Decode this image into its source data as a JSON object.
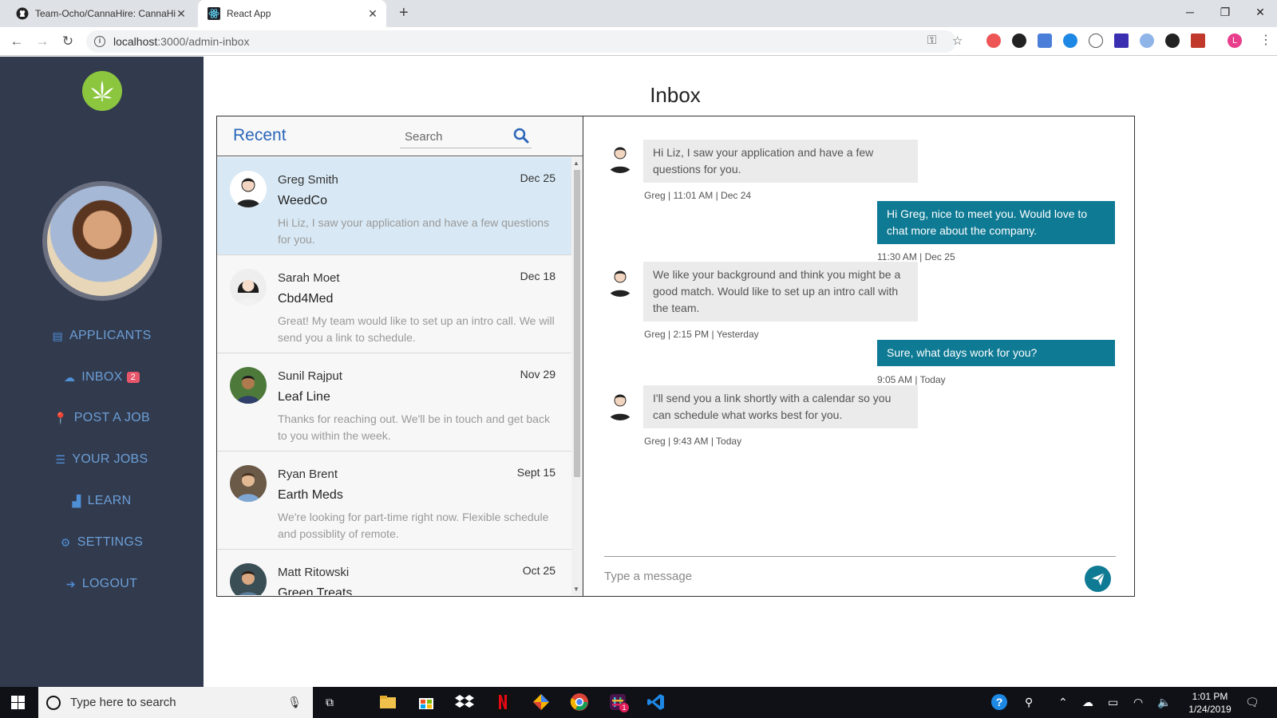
{
  "browser": {
    "tabs": [
      {
        "title": "Team-Ocho/CannaHire: CannaHire",
        "icon": "github-icon"
      },
      {
        "title": "React App",
        "icon": "react-icon"
      }
    ],
    "url_host": "localhost",
    "url_path": ":3000/admin-inbox",
    "new_tab": "+",
    "profile_initial": "L"
  },
  "sidebar": {
    "nav": [
      {
        "label": "APPLICANTS",
        "icon": "applicants-icon"
      },
      {
        "label": "INBOX",
        "icon": "inbox-icon",
        "badge": "2"
      },
      {
        "label": "POST A JOB",
        "icon": "pin-icon"
      },
      {
        "label": "YOUR JOBS",
        "icon": "list-icon"
      },
      {
        "label": "LEARN",
        "icon": "chart-icon"
      },
      {
        "label": "SETTINGS",
        "icon": "gear-icon"
      },
      {
        "label": "LOGOUT",
        "icon": "logout-icon"
      }
    ]
  },
  "page": {
    "title": "Inbox"
  },
  "recent": {
    "title": "Recent",
    "search_placeholder": "Search",
    "conversations": [
      {
        "name": "Greg Smith",
        "date": "Dec 25",
        "company": "WeedCo",
        "snippet": "Hi Liz, I saw your application and have a few questions for you."
      },
      {
        "name": "Sarah Moet",
        "date": "Dec 18",
        "company": "Cbd4Med",
        "snippet": "Great! My team would like to set up an intro call. We will send you a link to schedule."
      },
      {
        "name": "Sunil Rajput",
        "date": "Nov 29",
        "company": "Leaf Line",
        "snippet": "Thanks for reaching out. We'll be in touch and get back to you within the week."
      },
      {
        "name": "Ryan Brent",
        "date": "Sept 15",
        "company": "Earth Meds",
        "snippet": "We're looking for part-time right now. Flexible schedule and possiblity of remote."
      },
      {
        "name": "Matt Ritowski",
        "date": "Oct 25",
        "company": "Green Treats",
        "snippet": ""
      }
    ]
  },
  "thread": {
    "messages": [
      {
        "dir": "in",
        "text": "Hi Liz, I saw your application and have a few questions for you.",
        "meta": "Greg | 11:01 AM | Dec 24"
      },
      {
        "dir": "out",
        "text": "Hi Greg, nice to meet you. Would love to chat more about the company.",
        "meta": "11:30 AM | Dec 25"
      },
      {
        "dir": "in",
        "text": "We like your background and think you might be a good match. Would like to set up an intro call with the team.",
        "meta": "Greg | 2:15 PM | Yesterday"
      },
      {
        "dir": "out",
        "text": "Sure, what days work for you?",
        "meta": "9:05 AM | Today"
      },
      {
        "dir": "in",
        "text": "I'll send you a link shortly with a calendar so you can schedule what works best for you.",
        "meta": "Greg | 9:43 AM | Today"
      }
    ],
    "composer_placeholder": "Type a message"
  },
  "taskbar": {
    "search_placeholder": "Type here to search",
    "time": "1:01 PM",
    "date": "1/24/2019",
    "slack_badge": "1"
  },
  "colors": {
    "sidebar_bg": "#323a4e",
    "accent_blue": "#2a66b8",
    "outgoing_bubble": "#0e7a94",
    "selected_conversation": "#d8e9f5",
    "badge": "#e8566b"
  }
}
